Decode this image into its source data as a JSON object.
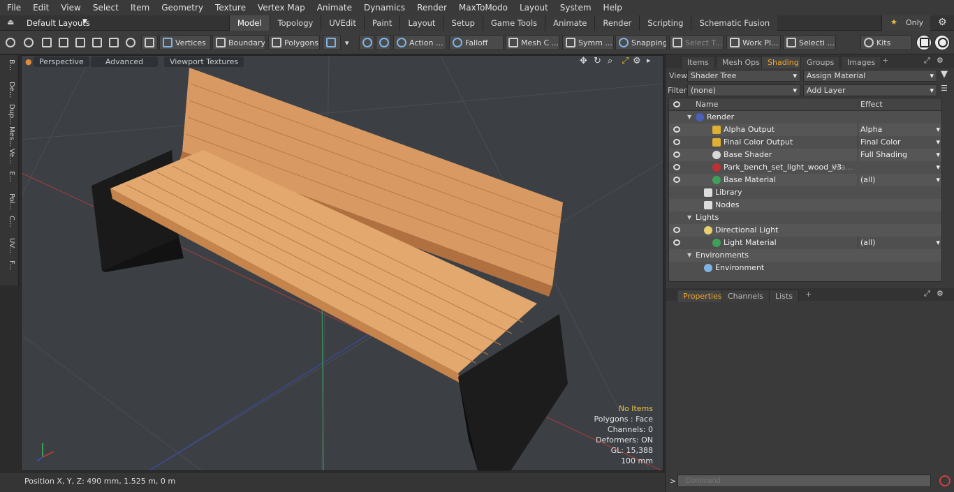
{
  "menu": [
    "File",
    "Edit",
    "View",
    "Select",
    "Item",
    "Geometry",
    "Texture",
    "Vertex Map",
    "Animate",
    "Dynamics",
    "Render",
    "MaxToModo",
    "Layout",
    "System",
    "Help"
  ],
  "layouts_label": "Default Layouts",
  "mode_tabs": [
    "Model",
    "Topology",
    "UVEdit",
    "Paint",
    "Layout",
    "Setup",
    "Game Tools",
    "Animate",
    "Render",
    "Scripting",
    "Schematic Fusion"
  ],
  "active_mode_tab": "Model",
  "only_label": "Only",
  "toolbar": {
    "vertices": "Vertices",
    "boundary": "Boundary",
    "polygons": "Polygons",
    "action": "Action ...",
    "falloff": "Falloff",
    "mesh": "Mesh C ...",
    "symmetry": "Symm ...",
    "snapping": "Snapping",
    "select_t": "Select T...",
    "work_plane": "Work Pl...",
    "selection": "Selecti ...",
    "kits": "Kits"
  },
  "left_tabs": [
    "B...",
    "De...",
    "Dup...",
    "Mes...",
    "Ve...",
    "E...",
    "Pol...",
    "C...",
    "UV...",
    "F..."
  ],
  "viewport": {
    "perspective": "Perspective",
    "advanced": "Advanced",
    "viewport_textures": "Viewport Textures",
    "info": {
      "selection": "No Items",
      "polygons": "Polygons : Face",
      "channels": "Channels: 0",
      "deformers": "Deformers: ON",
      "gl": "GL: 15,388",
      "grid": "100 mm"
    }
  },
  "status": {
    "position": "Position X, Y, Z:   490 mm, 1.525 m, 0 m"
  },
  "right_panel": {
    "tabs": [
      "Items",
      "Mesh Ops",
      "Shading",
      "Groups",
      "Images"
    ],
    "active_tab": "Shading",
    "view_label": "View",
    "view_value": "Shader Tree",
    "assign_material": "Assign Material",
    "filter_label": "Filter",
    "filter_value": "(none)",
    "add_layer": "Add Layer",
    "col_name": "Name",
    "col_effect": "Effect",
    "rows": [
      {
        "name": "Render",
        "effect": "",
        "indent": 0,
        "eye": false,
        "icon": "render-ball-icon",
        "color": "#4a5fb5"
      },
      {
        "name": "Alpha Output",
        "effect": "Alpha",
        "indent": 2,
        "eye": true,
        "icon": "output-icon",
        "color": "#e0b030"
      },
      {
        "name": "Final Color Output",
        "effect": "Final Color",
        "indent": 2,
        "eye": true,
        "icon": "output-icon",
        "color": "#e0b030"
      },
      {
        "name": "Base Shader",
        "effect": "Full Shading",
        "indent": 2,
        "eye": true,
        "icon": "shader-ball-icon",
        "color": "#d9d9d9"
      },
      {
        "name": "Park_bench_set_light_wood_v3",
        "effect": "",
        "suffix": "(Ma...",
        "indent": 2,
        "eye": true,
        "icon": "material-ball-icon",
        "color": "#c03030"
      },
      {
        "name": "Base Material",
        "effect": "(all)",
        "indent": 2,
        "eye": true,
        "icon": "material-ball-icon",
        "color": "#3fa05a"
      },
      {
        "name": "Library",
        "effect": "",
        "indent": 1,
        "eye": false,
        "icon": "folder-icon",
        "color": "#ddd"
      },
      {
        "name": "Nodes",
        "effect": "",
        "indent": 1,
        "eye": false,
        "icon": "folder-icon",
        "color": "#ddd"
      },
      {
        "name": "Lights",
        "effect": "",
        "indent": 0,
        "eye": false,
        "icon": "",
        "color": ""
      },
      {
        "name": "Directional Light",
        "effect": "",
        "indent": 1,
        "eye": true,
        "icon": "light-icon",
        "color": "#e8d070"
      },
      {
        "name": "Light Material",
        "effect": "(all)",
        "indent": 2,
        "eye": true,
        "icon": "material-ball-icon",
        "color": "#3fa05a"
      },
      {
        "name": "Environments",
        "effect": "",
        "indent": 0,
        "eye": false,
        "icon": "",
        "color": ""
      },
      {
        "name": "Environment",
        "effect": "",
        "indent": 1,
        "eye": false,
        "icon": "environment-icon",
        "color": "#7fb3e6"
      }
    ],
    "bottom_tabs": [
      "Properties",
      "Channels",
      "Lists"
    ],
    "active_bottom_tab": "Properties"
  },
  "command_placeholder": "Command"
}
